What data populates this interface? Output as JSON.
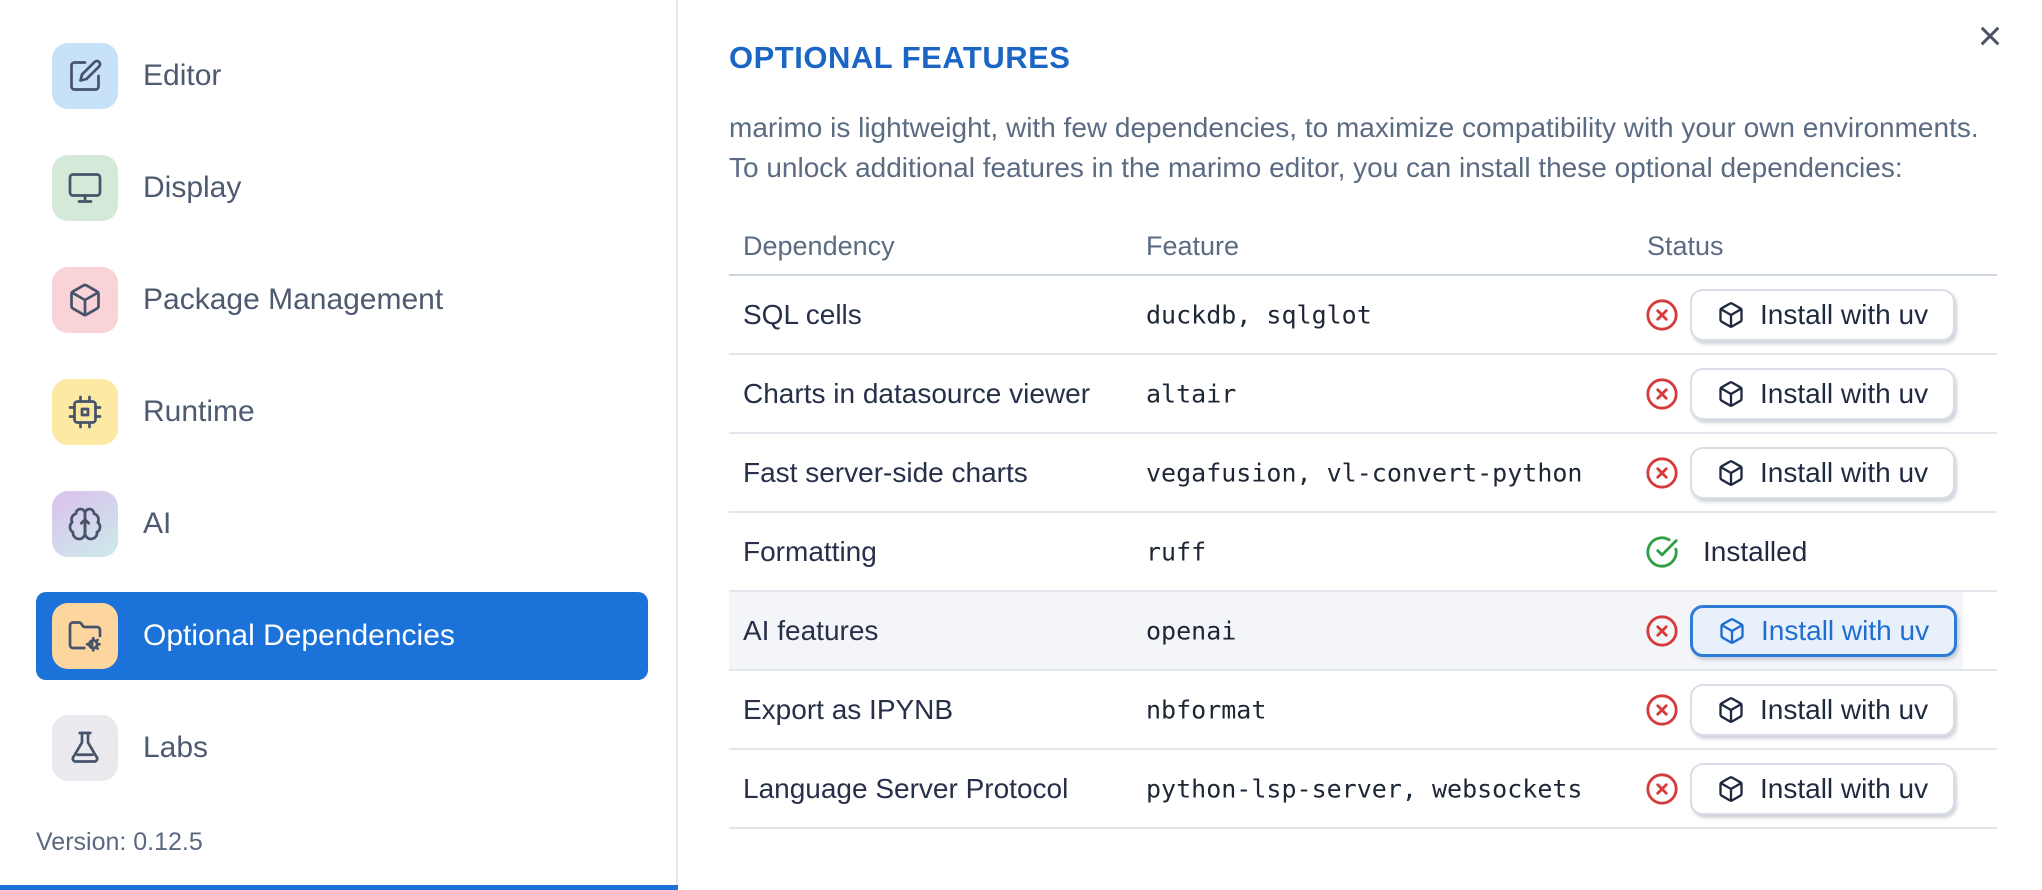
{
  "sidebar": {
    "items": [
      {
        "label": "Editor",
        "icon": "square-pen-icon",
        "icon_bg": "#c7e1f8",
        "selected": false
      },
      {
        "label": "Display",
        "icon": "monitor-icon",
        "icon_bg": "#d4e9d7",
        "selected": false
      },
      {
        "label": "Package Management",
        "icon": "package-icon",
        "icon_bg": "#f9d3d8",
        "selected": false
      },
      {
        "label": "Runtime",
        "icon": "cpu-icon",
        "icon_bg": "#fbe9a4",
        "selected": false
      },
      {
        "label": "AI",
        "icon": "brain-icon",
        "icon_bg": "linear-gradient(150deg, #d9c6ec 15%, #cde7eb 90%)",
        "selected": false
      },
      {
        "label": "Optional Dependencies",
        "icon": "folder-cog-icon",
        "icon_bg": "#fcd69e",
        "selected": true
      },
      {
        "label": "Labs",
        "icon": "flask-icon",
        "icon_bg": "#e9e9ee",
        "selected": false
      }
    ],
    "version": "Version: 0.12.5",
    "selected_bg": "#1b72d8"
  },
  "panel": {
    "title": "OPTIONAL FEATURES",
    "description_line1": "marimo is lightweight, with few dependencies, to maximize compatibility with your own environments.",
    "description_line2": "To unlock additional features in the marimo editor, you can install these optional dependencies:",
    "close_label": "×",
    "table": {
      "headers": [
        "Dependency",
        "Feature",
        "Status"
      ],
      "rows": [
        {
          "dependency": "SQL cells",
          "feature": "duckdb, sqlglot",
          "installed": false,
          "action": "Install with uv",
          "highlighted": false
        },
        {
          "dependency": "Charts in datasource viewer",
          "feature": "altair",
          "installed": false,
          "action": "Install with uv",
          "highlighted": false
        },
        {
          "dependency": "Fast server-side charts",
          "feature": "vegafusion, vl-convert-python",
          "installed": false,
          "action": "Install with uv",
          "highlighted": false
        },
        {
          "dependency": "Formatting",
          "feature": "ruff",
          "installed": true,
          "status_text": "Installed",
          "highlighted": false
        },
        {
          "dependency": "AI features",
          "feature": "openai",
          "installed": false,
          "action": "Install with uv",
          "highlighted": true
        },
        {
          "dependency": "Export as IPYNB",
          "feature": "nbformat",
          "installed": false,
          "action": "Install with uv",
          "highlighted": false
        },
        {
          "dependency": "Language Server Protocol",
          "feature": "python-lsp-server, websockets",
          "installed": false,
          "action": "Install with uv",
          "highlighted": false
        }
      ]
    },
    "colors": {
      "accent": "#1b66c4",
      "selected": "#1b72d8",
      "error": "#d63b3b",
      "success": "#2f9e44"
    }
  }
}
